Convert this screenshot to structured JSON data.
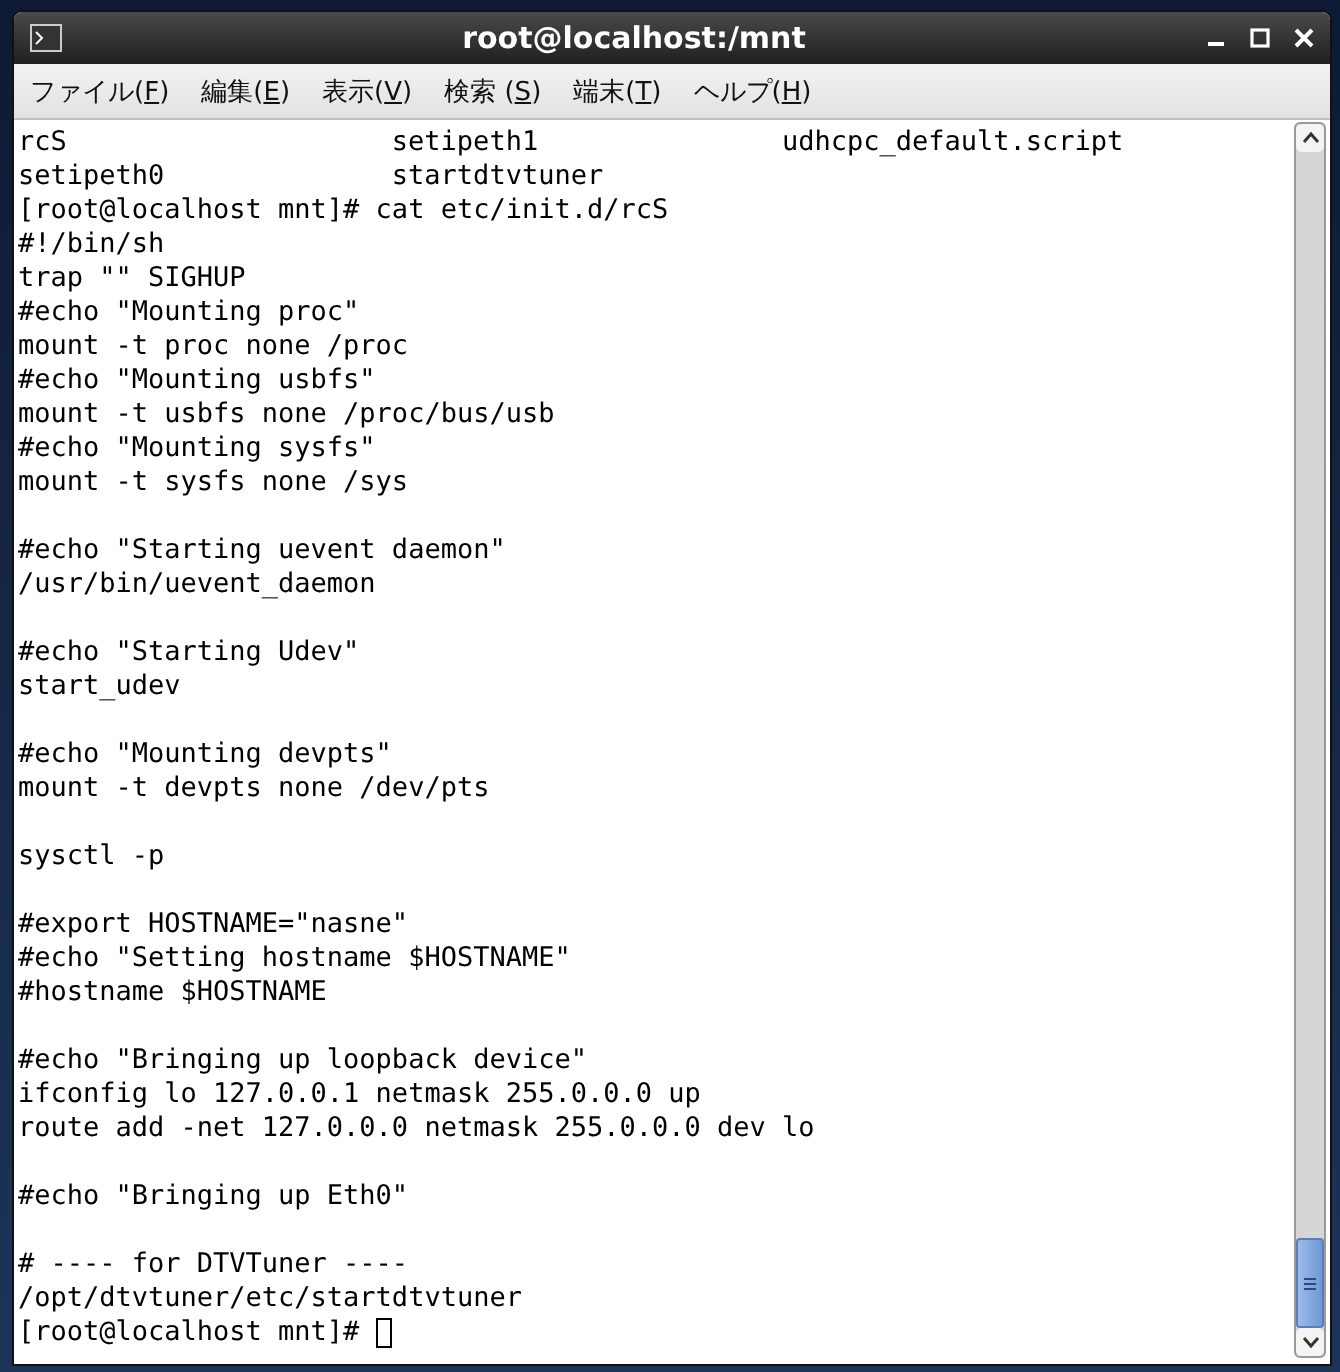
{
  "window": {
    "title": "root@localhost:/mnt"
  },
  "menu": [
    {
      "label": "ファイル(",
      "key": "F",
      "after": ")"
    },
    {
      "label": "編集(",
      "key": "E",
      "after": ")"
    },
    {
      "label": "表示(",
      "key": "V",
      "after": ")"
    },
    {
      "label": "検索 (",
      "key": "S",
      "after": ")"
    },
    {
      "label": "端末(",
      "key": "T",
      "after": ")"
    },
    {
      "label": "ヘルプ(",
      "key": "H",
      "after": ")"
    }
  ],
  "terminal": {
    "lines": [
      {
        "kind": "columns",
        "items": [
          "rcS",
          "setipeth1",
          "udhcpc_default.script"
        ]
      },
      {
        "kind": "columns",
        "items": [
          "setipeth0",
          "startdtvtuner"
        ]
      },
      {
        "kind": "text",
        "text": "[root@localhost mnt]# cat etc/init.d/rcS"
      },
      {
        "kind": "text",
        "text": "#!/bin/sh"
      },
      {
        "kind": "text",
        "text": "trap \"\" SIGHUP"
      },
      {
        "kind": "text",
        "text": "#echo \"Mounting proc\""
      },
      {
        "kind": "text",
        "text": "mount -t proc none /proc"
      },
      {
        "kind": "text",
        "text": "#echo \"Mounting usbfs\""
      },
      {
        "kind": "text",
        "text": "mount -t usbfs none /proc/bus/usb"
      },
      {
        "kind": "text",
        "text": "#echo \"Mounting sysfs\""
      },
      {
        "kind": "text",
        "text": "mount -t sysfs none /sys"
      },
      {
        "kind": "blank"
      },
      {
        "kind": "text",
        "text": "#echo \"Starting uevent daemon\""
      },
      {
        "kind": "text",
        "text": "/usr/bin/uevent_daemon"
      },
      {
        "kind": "blank"
      },
      {
        "kind": "text",
        "text": "#echo \"Starting Udev\""
      },
      {
        "kind": "text",
        "text": "start_udev"
      },
      {
        "kind": "blank"
      },
      {
        "kind": "text",
        "text": "#echo \"Mounting devpts\""
      },
      {
        "kind": "text",
        "text": "mount -t devpts none /dev/pts"
      },
      {
        "kind": "blank"
      },
      {
        "kind": "text",
        "text": "sysctl -p"
      },
      {
        "kind": "blank"
      },
      {
        "kind": "text",
        "text": "#export HOSTNAME=\"nasne\""
      },
      {
        "kind": "text",
        "text": "#echo \"Setting hostname $HOSTNAME\""
      },
      {
        "kind": "text",
        "text": "#hostname $HOSTNAME"
      },
      {
        "kind": "blank"
      },
      {
        "kind": "text",
        "text": "#echo \"Bringing up loopback device\""
      },
      {
        "kind": "text",
        "text": "ifconfig lo 127.0.0.1 netmask 255.0.0.0 up"
      },
      {
        "kind": "text",
        "text": "route add -net 127.0.0.0 netmask 255.0.0.0 dev lo"
      },
      {
        "kind": "blank"
      },
      {
        "kind": "text",
        "text": "#echo \"Bringing up Eth0\""
      },
      {
        "kind": "blank"
      },
      {
        "kind": "text",
        "text": "# ---- for DTVTuner ----"
      },
      {
        "kind": "text",
        "text": "/opt/dtvtuner/etc/startdtvtuner"
      },
      {
        "kind": "prompt",
        "text": "[root@localhost mnt]#",
        "cursor": true
      }
    ]
  }
}
